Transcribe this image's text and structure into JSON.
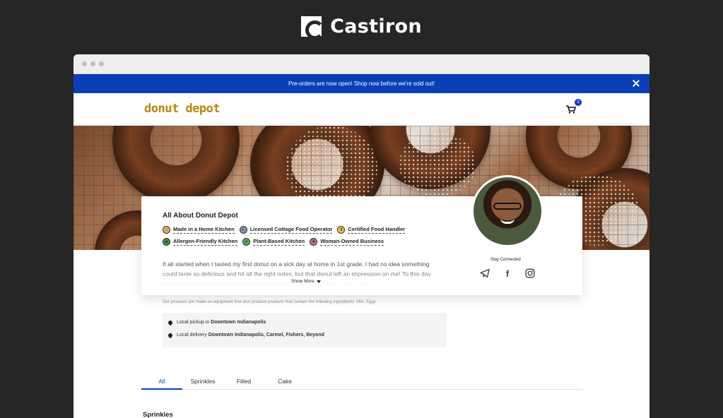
{
  "brand": {
    "name": "Castiron",
    "logo_icon": "castiron-logo-icon"
  },
  "announcement": {
    "text": "Pre-orders are now open! Shop now before we're sold out!",
    "close_icon": "close-icon"
  },
  "store": {
    "logo_text": "donut depot",
    "cart_icon": "cart-icon",
    "cart_count": "3"
  },
  "profile": {
    "title": "All About Donut Depot",
    "tags": [
      {
        "label": "Made in a Home Kitchen",
        "icon": "home-icon",
        "color": "#e9b15f"
      },
      {
        "label": "Licensed Cottage Food Operator",
        "icon": "badge-icon",
        "color": "#8a95a8"
      },
      {
        "label": "Certified Food Handler",
        "icon": "utensils-icon",
        "color": "#f2c94c"
      },
      {
        "label": "Allergen-Friendly Kitchen",
        "icon": "allergen-icon",
        "color": "#3e8f4e"
      },
      {
        "label": "Plant-Based Kitchen",
        "icon": "leaf-icon",
        "color": "#56ab5e"
      },
      {
        "label": "Woman-Owned Business",
        "icon": "heart-icon",
        "color": "#c0707a"
      }
    ],
    "about": "It all started when I tasted my first donut on a sick day at home in 1st grade. I had no idea something could taste so delicious and hit all the right notes, but that donut left an impression on me! To this day it's still my favorite flavor of donut to make and my customers love it too! I bake",
    "show_more": "Show More",
    "stay_connected": "Stay Connected",
    "socials": [
      "telegram-icon",
      "facebook-icon",
      "instagram-icon"
    ],
    "allergen_note": "Our products are made on equipment that also produce products that contain the following ingredients: Milk, Eggs",
    "pickup": {
      "prefix": "Local pickup in ",
      "place": "Downtown Indianapolis"
    },
    "delivery": {
      "prefix": "Local delivery ",
      "places": "Downtown Indianapolis, Carmel, Fishers, Beyond"
    }
  },
  "tabs": [
    "All",
    "Sprinkles",
    "Filled",
    "Cake"
  ],
  "active_tab": "All",
  "section_heading": "Sprinkles"
}
